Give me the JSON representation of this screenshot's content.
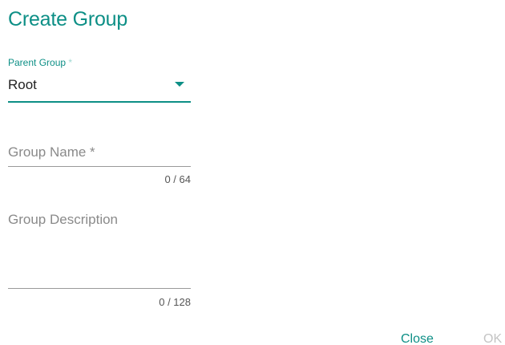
{
  "dialog": {
    "title": "Create Group"
  },
  "parent_group": {
    "label": "Parent Group",
    "required_mark": "*",
    "value": "Root"
  },
  "group_name": {
    "placeholder": "Group Name *",
    "counter": "0 / 64"
  },
  "group_description": {
    "placeholder": "Group Description",
    "counter": "0 / 128"
  },
  "actions": {
    "close_label": "Close",
    "ok_label": "OK"
  },
  "colors": {
    "accent": "#0d8f86",
    "disabled": "#c4c4c4"
  },
  "icons": {
    "dropdown": "chevron-down-icon"
  }
}
